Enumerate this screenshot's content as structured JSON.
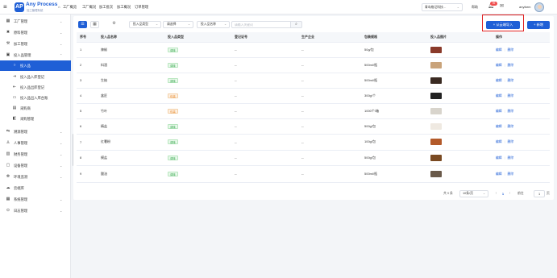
{
  "app": {
    "logo_title": "Any Process",
    "logo_sub": "加工管理系统",
    "logo_mark": "AP"
  },
  "topbar": {
    "nav": [
      "工厂概览",
      "工厂概况",
      "加工批次",
      "加工概况",
      "订单管理"
    ],
    "org_select": "青岛格记科技…",
    "help_label": "帮助",
    "notification_count": "99",
    "username": "anyfarm"
  },
  "sidebar": {
    "items": [
      {
        "label": "工厂管理",
        "icon": "factory-icon"
      },
      {
        "label": "原料管理",
        "icon": "material-icon"
      },
      {
        "label": "加工管理",
        "icon": "process-icon"
      },
      {
        "label": "投入品管理",
        "icon": "input-icon"
      },
      {
        "label": "投入品",
        "icon": "input-item-icon"
      },
      {
        "label": "投入品入库登记",
        "icon": "inbound-icon"
      },
      {
        "label": "投入品出库登记",
        "icon": "outbound-icon"
      },
      {
        "label": "投入品出入库台账",
        "icon": "ledger-icon"
      },
      {
        "label": "采购商",
        "icon": "buyer-icon"
      },
      {
        "label": "采购管理",
        "icon": "purchase-icon"
      },
      {
        "label": "溯源管理",
        "icon": "trace-icon"
      },
      {
        "label": "人事管理",
        "icon": "person-icon"
      },
      {
        "label": "财务管理",
        "icon": "finance-icon"
      },
      {
        "label": "设备管理",
        "icon": "device-icon"
      },
      {
        "label": "环境监测",
        "icon": "environment-icon"
      },
      {
        "label": "云端库",
        "icon": "cloud-icon"
      },
      {
        "label": "系统管理",
        "icon": "system-icon"
      },
      {
        "label": "日志管理",
        "icon": "log-icon"
      }
    ]
  },
  "filters": {
    "type_label": "投入品类型",
    "select_label": "请选择",
    "name_label": "投入品名称",
    "search_placeholder": "请输入关键词"
  },
  "actions": {
    "import_label": "+ 从云端导入",
    "add_label": "+ 新增"
  },
  "table": {
    "headers": [
      "序号",
      "投入品名称",
      "投入品类型",
      "登记证号",
      "生产企业",
      "包装规格",
      "投入品图片",
      "操作"
    ],
    "rows": [
      {
        "no": "1",
        "name": "辣椒",
        "type": "调味",
        "reg": "--",
        "maker": "--",
        "spec": "50g/包",
        "tag": "green"
      },
      {
        "no": "2",
        "name": "料酒",
        "type": "调味",
        "reg": "--",
        "maker": "--",
        "spec": "500ml/瓶",
        "tag": "green"
      },
      {
        "no": "3",
        "name": "生抽",
        "type": "调味",
        "reg": "--",
        "maker": "--",
        "spec": "500ml/瓶",
        "tag": "green"
      },
      {
        "no": "4",
        "name": "盒匠",
        "type": "包装",
        "reg": "--",
        "maker": "--",
        "spec": "300g/个",
        "tag": "orange"
      },
      {
        "no": "5",
        "name": "竹叶",
        "type": "包装",
        "reg": "--",
        "maker": "--",
        "spec": "1000个/箱",
        "tag": "orange"
      },
      {
        "no": "6",
        "name": "精盐",
        "type": "调味",
        "reg": "--",
        "maker": "--",
        "spec": "500g/包",
        "tag": "green"
      },
      {
        "no": "7",
        "name": "红薯粉",
        "type": "调味",
        "reg": "--",
        "maker": "--",
        "spec": "100g/包",
        "tag": "green"
      },
      {
        "no": "8",
        "name": "模盐",
        "type": "调味",
        "reg": "--",
        "maker": "--",
        "spec": "500g/包",
        "tag": "green"
      },
      {
        "no": "9",
        "name": "酸油",
        "type": "调味",
        "reg": "--",
        "maker": "--",
        "spec": "500ml/瓶",
        "tag": "green"
      }
    ],
    "edit_label": "编辑",
    "delete_label": "删除",
    "thumb_colors": [
      "#8a3a2a",
      "#c9a37a",
      "#3a2a22",
      "#222222",
      "#d8d4cc",
      "#efe9e1",
      "#b35a2a",
      "#7a4a22",
      "#6a5a4a"
    ]
  },
  "pagination": {
    "total": "共 9 条",
    "page_size": "10条/页",
    "current": "1",
    "goto_label": "前往",
    "goto_value": "1",
    "page_suffix": "页"
  },
  "colors": {
    "primary": "#1f5fd6",
    "highlight": "#e02020"
  }
}
